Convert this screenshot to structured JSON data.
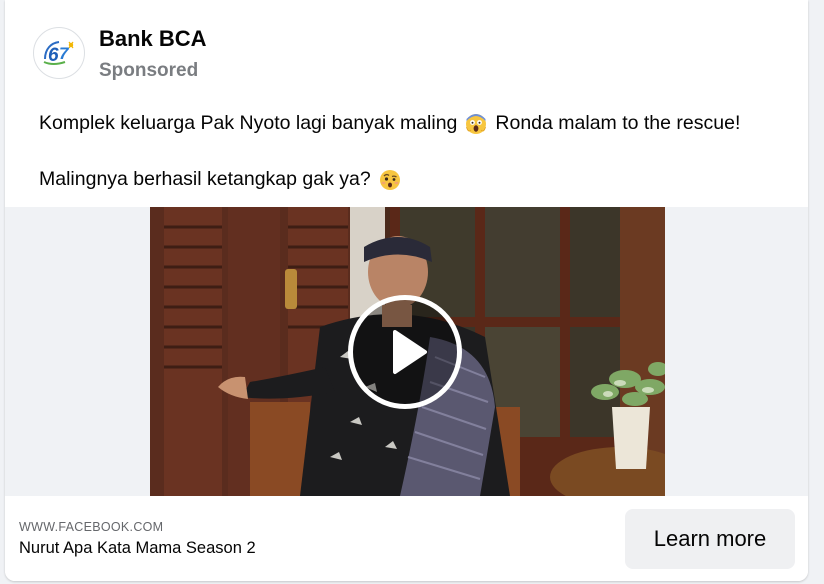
{
  "post": {
    "advertiser_name": "Bank BCA",
    "sponsored_label": "Sponsored",
    "avatar_icon": "bca-67-anniversary-logo-icon",
    "text_line1_a": "Komplek keluarga Pak Nyoto lagi banyak maling",
    "text_line1_emoji": "face-screaming-in-fear-emoji",
    "text_line1_b": "Ronda malam to the rescue!",
    "text_line2_a": "Malingnya berhasil ketangkap gak ya?",
    "text_line2_emoji": "face-with-raised-eyebrow-emoji"
  },
  "media": {
    "type": "video",
    "play_icon": "play-icon"
  },
  "link": {
    "domain": "WWW.FACEBOOK.COM",
    "title": "Nurut Apa Kata Mama Season 2",
    "cta_label": "Learn more"
  },
  "colors": {
    "text_primary": "#050505",
    "text_secondary": "#65676b",
    "cta_background": "#eff0f2",
    "media_background": "#f0f2f5"
  }
}
